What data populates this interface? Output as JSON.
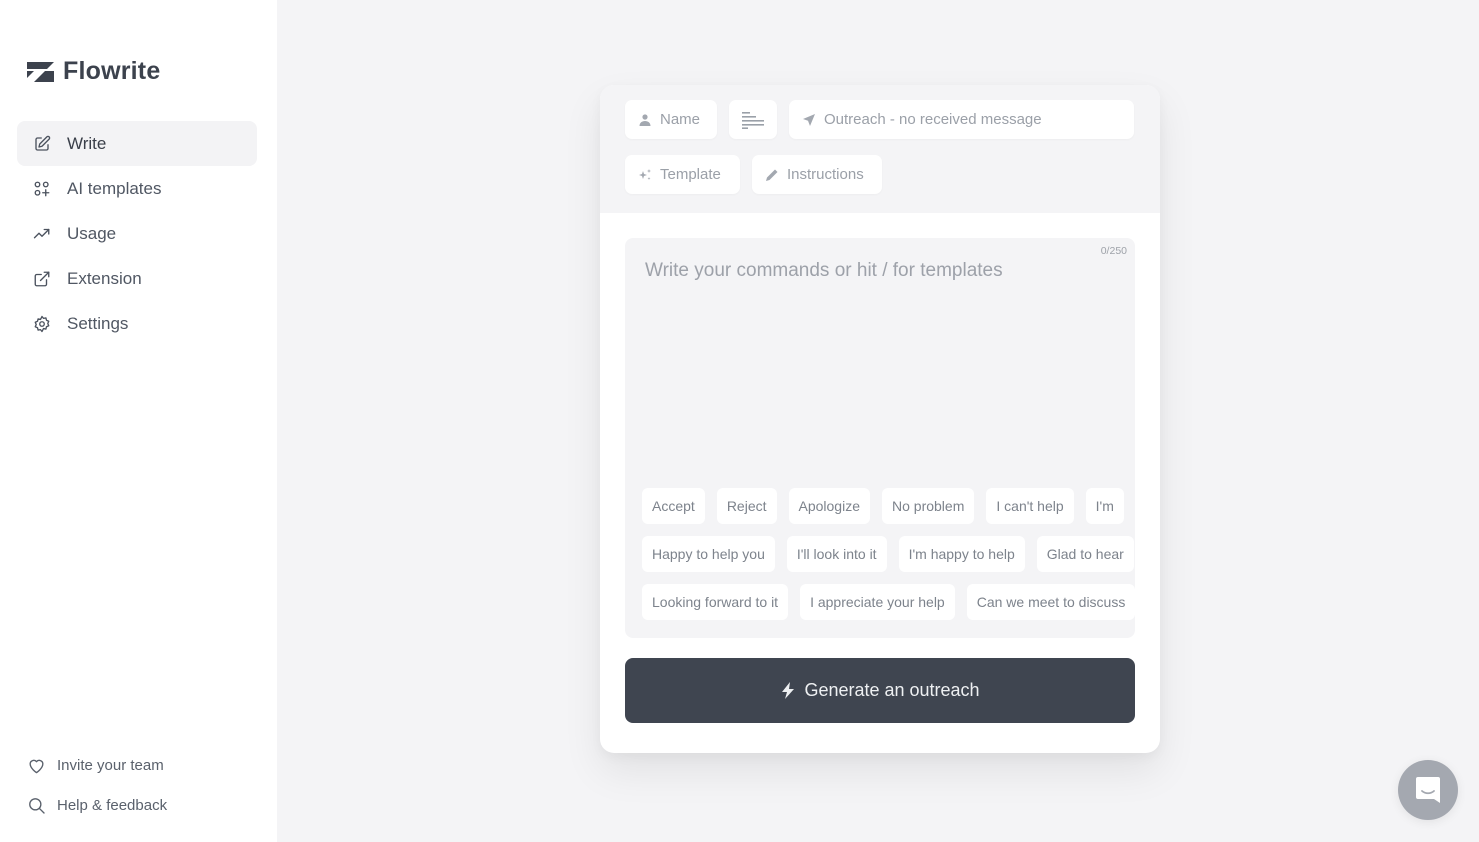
{
  "app": {
    "name": "Flowrite"
  },
  "sidebar": {
    "items": [
      {
        "label": "Write",
        "icon": "edit-icon",
        "active": true
      },
      {
        "label": "AI templates",
        "icon": "templates-grid-icon",
        "active": false
      },
      {
        "label": "Usage",
        "icon": "trending-up-icon",
        "active": false
      },
      {
        "label": "Extension",
        "icon": "external-link-icon",
        "active": false
      },
      {
        "label": "Settings",
        "icon": "gear-icon",
        "active": false
      }
    ],
    "bottom": [
      {
        "label": "Invite your team",
        "icon": "heart-icon"
      },
      {
        "label": "Help & feedback",
        "icon": "search-icon"
      }
    ]
  },
  "composer": {
    "name_label": "Name",
    "length_icon": "text-length-icon",
    "type_label": "Outreach - no received message",
    "template_label": "Template",
    "instructions_label": "Instructions",
    "placeholder": "Write your commands or hit / for templates",
    "counter": "0/250",
    "chip_rows": [
      [
        "Accept",
        "Reject",
        "Apologize",
        "No problem",
        "I can't help",
        "I'm"
      ],
      [
        "Happy to help you",
        "I'll look into it",
        "I'm happy to help",
        "Glad to hear"
      ],
      [
        "Looking forward to it",
        "I appreciate your help",
        "Can we meet to discuss"
      ]
    ],
    "generate_label": "Generate an outreach"
  },
  "colors": {
    "primary_button": "#3f4550",
    "background": "#f4f4f6",
    "active_nav": "#f3f3f5"
  }
}
